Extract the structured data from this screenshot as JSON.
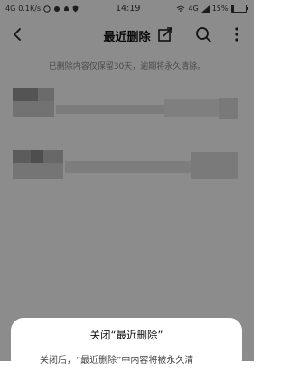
{
  "status_bar": {
    "network": "4G",
    "speed": "0.1K/s",
    "time": "14:19",
    "signal_label": "4G",
    "battery": "15%"
  },
  "toolbar": {
    "title": "最近删除",
    "back_icon": "back-arrow-icon",
    "select_icon": "select-box-icon",
    "search_icon": "search-icon",
    "more_icon": "more-vertical-icon"
  },
  "notice": "已删除内容仅保留30天，逾期将永久清除。",
  "items": [
    {
      "type": "blurred-content"
    },
    {
      "type": "blurred-content"
    }
  ],
  "dialog": {
    "title": "关闭“最近删除”",
    "body_partial": "关闭后，“最近删除”中内容将被永久清"
  },
  "colors": {
    "overlay": "rgba(0,0,0,0.45)",
    "sheet": "#ffffff"
  }
}
